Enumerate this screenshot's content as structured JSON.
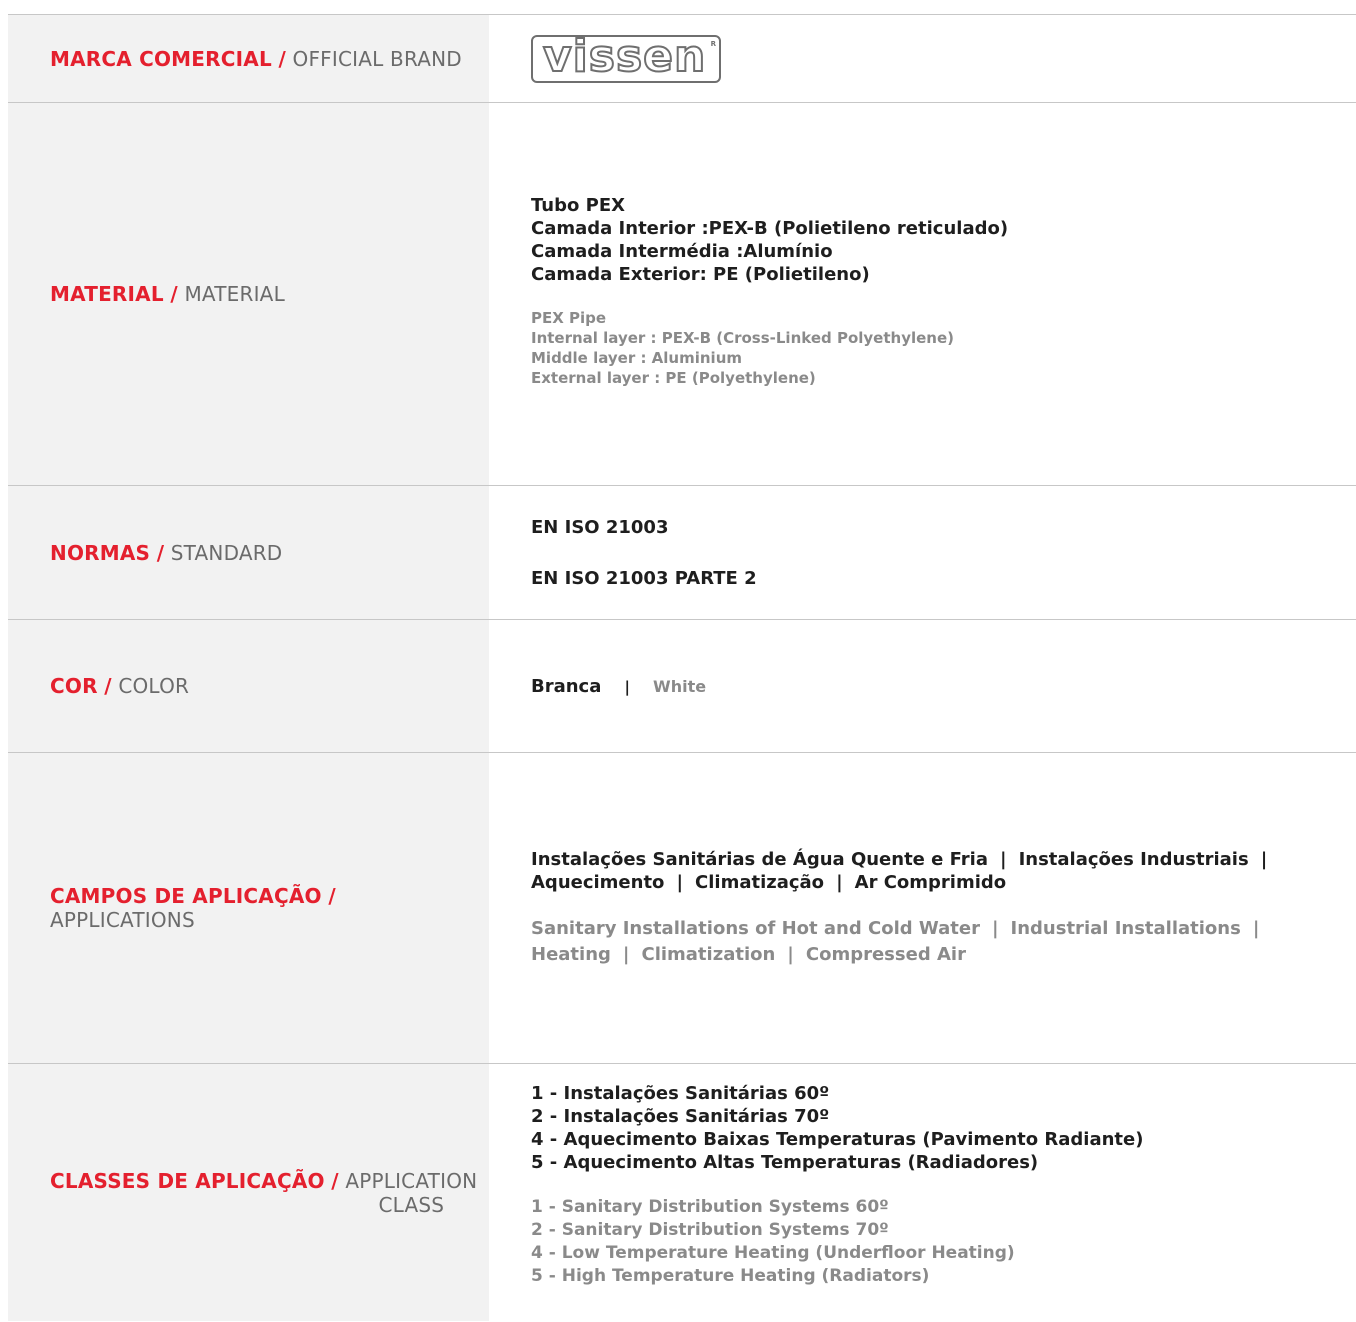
{
  "rows": {
    "brand": {
      "label_pt": "MARCA COMERCIAL",
      "separator": "/",
      "label_en": "OFFICIAL BRAND",
      "logo_text": "vissen",
      "logo_mark": "R"
    },
    "material": {
      "label_pt": "MATERIAL",
      "separator": "/",
      "label_en": "MATERIAL",
      "pt_lines": [
        "Tubo PEX",
        "Camada Interior :PEX-B (Polietileno reticulado)",
        "Camada Intermédia :Alumínio",
        "Camada Exterior: PE (Polietileno)"
      ],
      "en_lines": [
        "PEX Pipe",
        "Internal layer : PEX-B (Cross-Linked Polyethylene)",
        "Middle layer : Aluminium",
        "External layer : PE (Polyethylene)"
      ]
    },
    "standards": {
      "label_pt": "NORMAS",
      "separator": "/",
      "label_en": "STANDARD",
      "lines": [
        "EN ISO 21003",
        "EN ISO 21003 PARTE 2"
      ]
    },
    "color": {
      "label_pt": "COR",
      "separator": "/",
      "label_en": "COLOR",
      "value_pt": "Branca",
      "divider": "|",
      "value_en": "White"
    },
    "applications": {
      "label_pt": "CAMPOS DE APLICAÇÃO",
      "separator": "/",
      "label_en": "APPLICATIONS",
      "divider": "|",
      "pt_line1": [
        "Instalações Sanitárias de Água Quente e Fria",
        "Instalações Industriais"
      ],
      "pt_line2": [
        "Aquecimento",
        "Climatização",
        "Ar Comprimido"
      ],
      "en_line1": [
        "Sanitary Installations of Hot and Cold Water",
        "Industrial Installations"
      ],
      "en_line2": [
        "Heating",
        "Climatization",
        "Compressed Air"
      ]
    },
    "classes": {
      "label_pt": "CLASSES DE APLICAÇÃO",
      "separator": "/",
      "label_en_1": "APPLICATION",
      "label_en_2": "CLASS",
      "pt_lines": [
        "1 - Instalações Sanitárias  60º",
        "2 - Instalações Sanitárias  70º",
        "4 - Aquecimento Baixas Temperaturas (Pavimento Radiante)",
        "5 - Aquecimento Altas Temperaturas (Radiadores)"
      ],
      "en_lines": [
        "1 - Sanitary Distribution Systems  60º",
        "2 - Sanitary Distribution Systems  70º",
        "4 - Low Temperature Heating (Underfloor Heating)",
        "5 - High Temperature Heating (Radiators)"
      ]
    }
  },
  "colors": {
    "accent_red": "#e4202e",
    "label_gray": "#6b6b6b",
    "secondary_text": "#8a8a8a",
    "label_cell_bg": "#f2f2f2",
    "rule": "#c7c7c7"
  }
}
